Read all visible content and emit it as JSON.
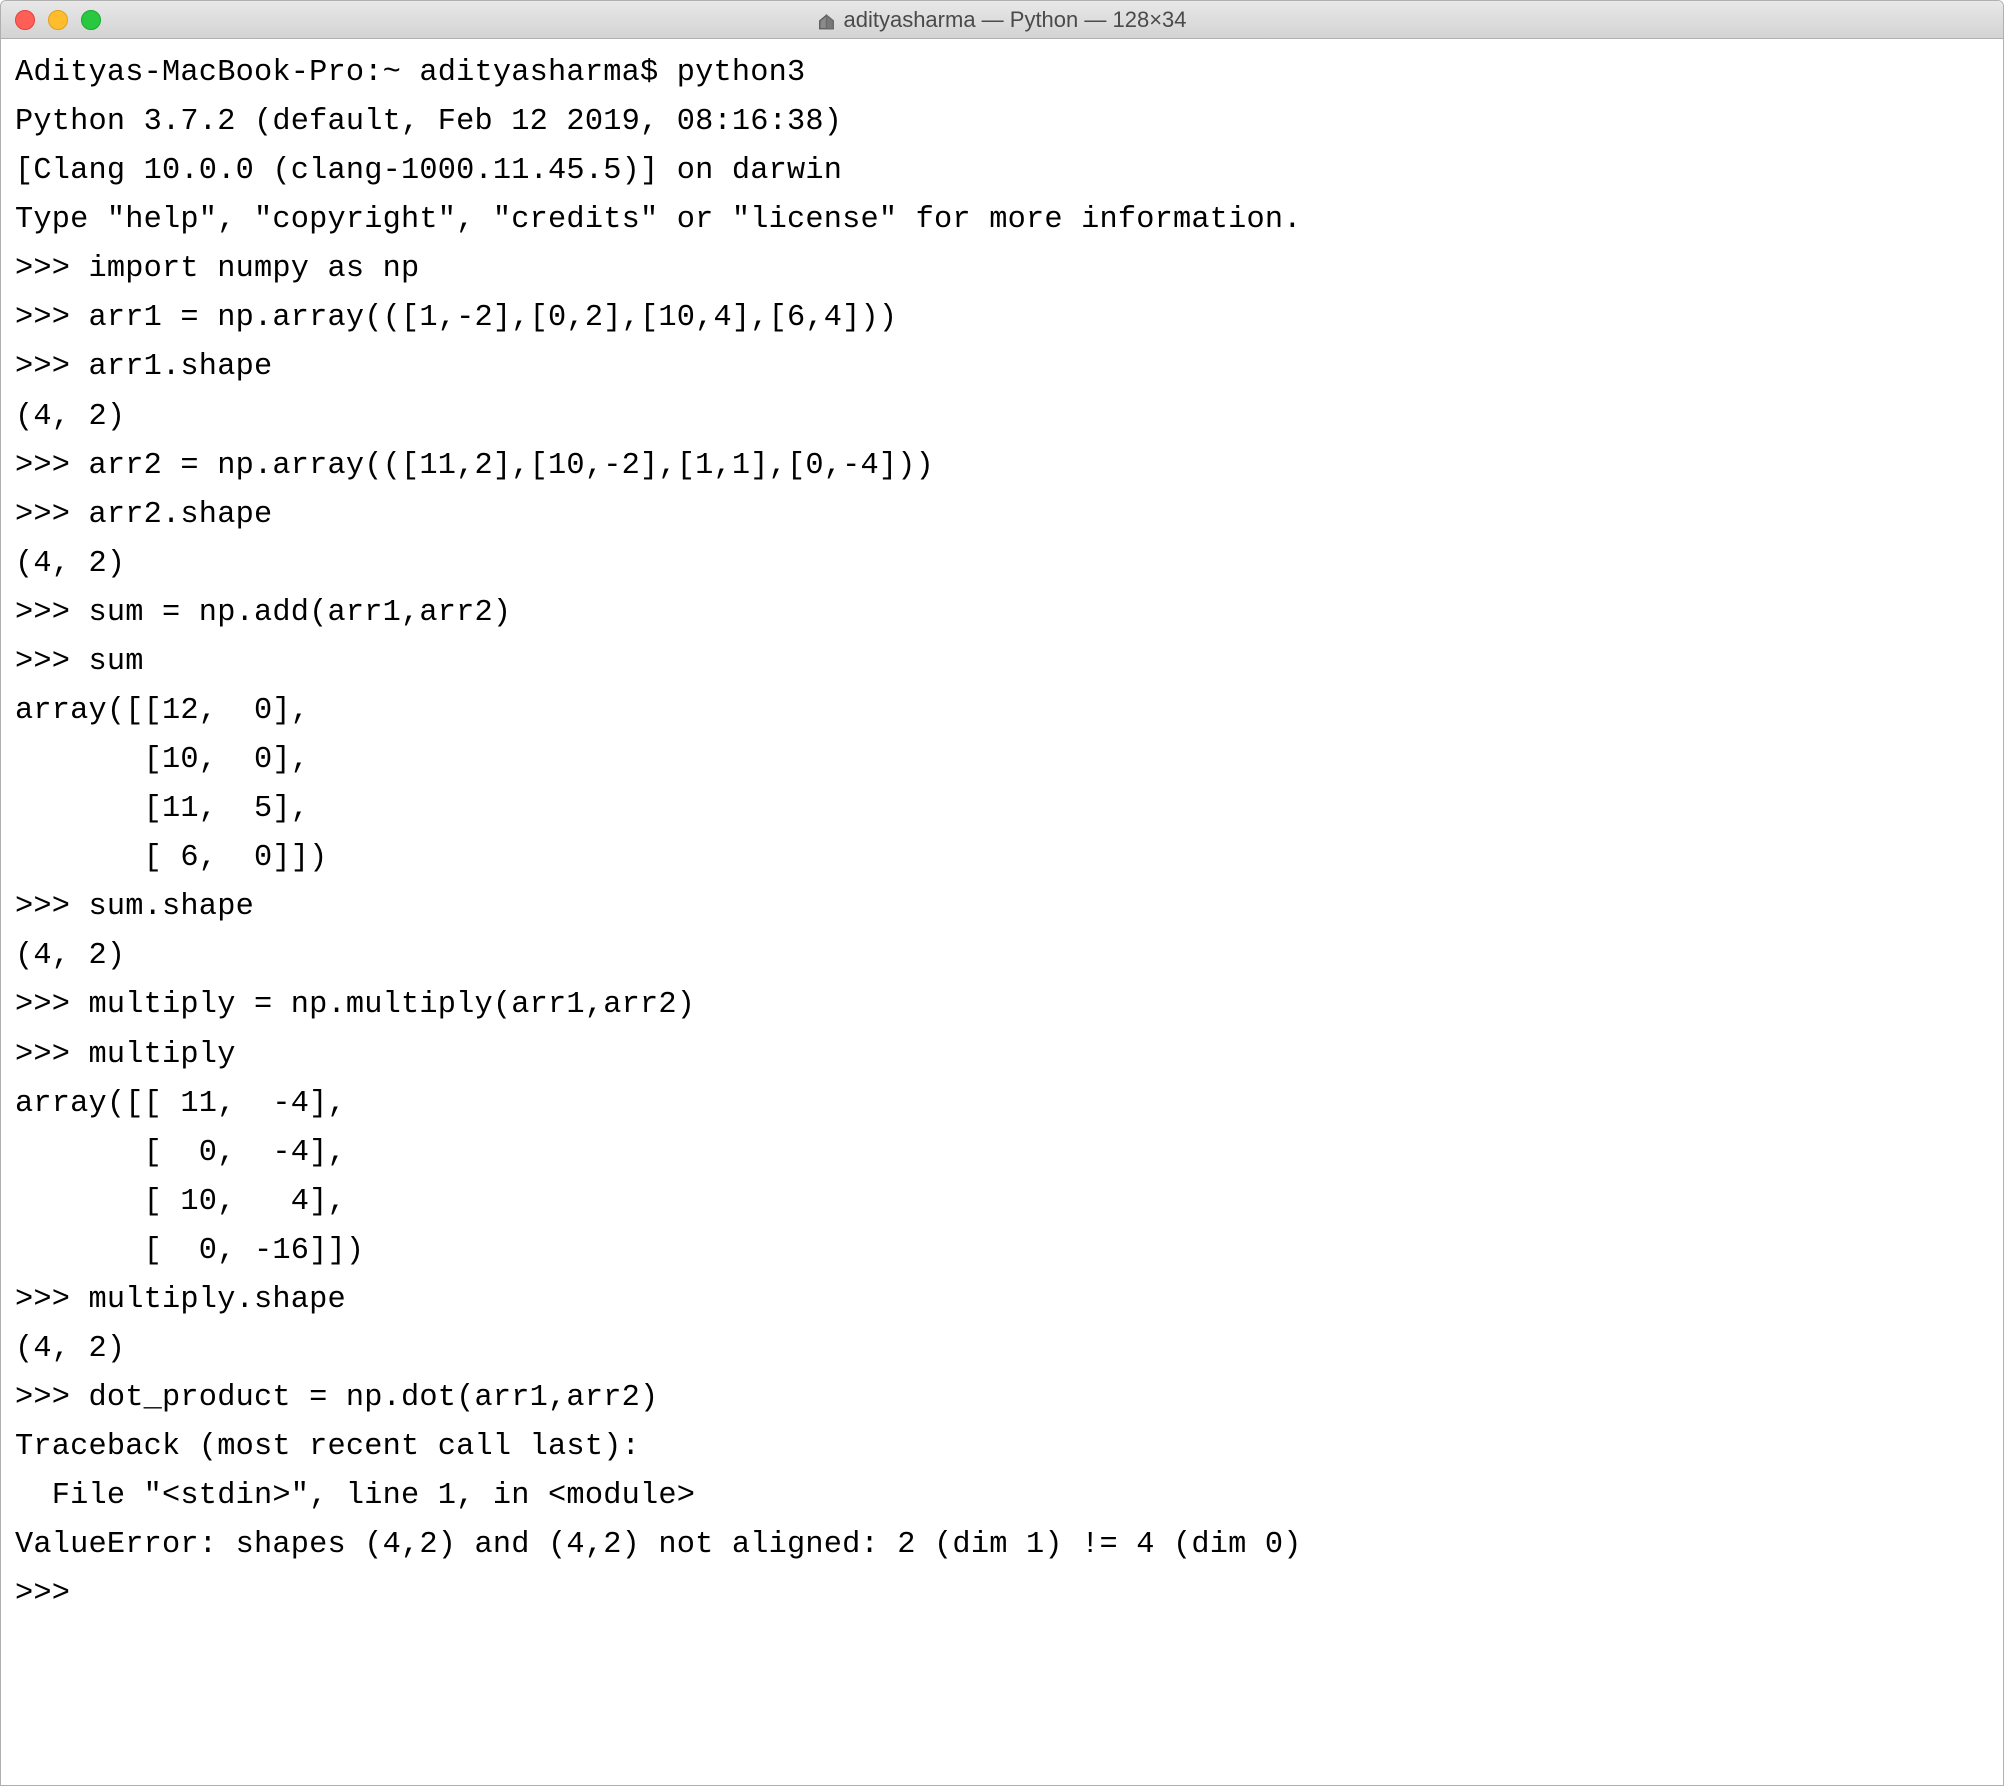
{
  "titlebar": {
    "title": "adityasharma — Python — 128×34"
  },
  "terminal": {
    "lines": [
      "Adityas-MacBook-Pro:~ adityasharma$ python3",
      "Python 3.7.2 (default, Feb 12 2019, 08:16:38) ",
      "[Clang 10.0.0 (clang-1000.11.45.5)] on darwin",
      "Type \"help\", \"copyright\", \"credits\" or \"license\" for more information.",
      ">>> import numpy as np",
      ">>> arr1 = np.array(([1,-2],[0,2],[10,4],[6,4]))",
      ">>> arr1.shape",
      "(4, 2)",
      ">>> arr2 = np.array(([11,2],[10,-2],[1,1],[0,-4]))",
      ">>> arr2.shape",
      "(4, 2)",
      ">>> sum = np.add(arr1,arr2)",
      ">>> sum",
      "array([[12,  0],",
      "       [10,  0],",
      "       [11,  5],",
      "       [ 6,  0]])",
      ">>> sum.shape",
      "(4, 2)",
      ">>> multiply = np.multiply(arr1,arr2)",
      ">>> multiply",
      "array([[ 11,  -4],",
      "       [  0,  -4],",
      "       [ 10,   4],",
      "       [  0, -16]])",
      ">>> multiply.shape",
      "(4, 2)",
      ">>> dot_product = np.dot(arr1,arr2)",
      "Traceback (most recent call last):",
      "  File \"<stdin>\", line 1, in <module>",
      "ValueError: shapes (4,2) and (4,2) not aligned: 2 (dim 1) != 4 (dim 0)",
      ">>> "
    ]
  }
}
